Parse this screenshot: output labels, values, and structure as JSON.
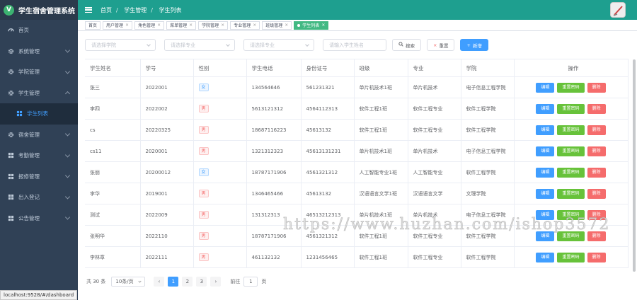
{
  "app": {
    "title": "学生宿舍管理系统",
    "logo_letter": "V"
  },
  "sidebar": {
    "items": [
      {
        "label": "首页",
        "icon": "dashboard-icon"
      },
      {
        "label": "系统管理",
        "icon": "gear-icon"
      },
      {
        "label": "学院管理",
        "icon": "gear-icon"
      },
      {
        "label": "学生管理",
        "icon": "gear-icon"
      },
      {
        "label": "学生列表",
        "icon": "grid-icon"
      },
      {
        "label": "宿舍管理",
        "icon": "gear-icon"
      },
      {
        "label": "考勤管理",
        "icon": "grid-icon"
      },
      {
        "label": "报修管理",
        "icon": "grid-icon"
      },
      {
        "label": "出入登记",
        "icon": "grid-icon"
      },
      {
        "label": "公告管理",
        "icon": "grid-icon"
      }
    ]
  },
  "breadcrumb": [
    "首页",
    "学生管理",
    "学生列表"
  ],
  "tags": [
    "首页",
    "用户管理",
    "角色管理",
    "菜单管理",
    "学院管理",
    "专业管理",
    "班级管理",
    "学生列表"
  ],
  "filters": {
    "college_placeholder": "请选择学院",
    "major_placeholder": "请选择专业",
    "class_placeholder": "请选择专业",
    "name_placeholder": "请输入学生姓名",
    "search_label": "搜索",
    "reset_label": "重置",
    "add_label": "新增"
  },
  "table": {
    "columns": [
      "学生姓名",
      "学号",
      "性别",
      "学生电话",
      "身份证号",
      "班级",
      "专业",
      "学院",
      "操作"
    ],
    "rows": [
      {
        "name": "张三",
        "no": "2022001",
        "gender": "女",
        "phone": "134564646",
        "id": "561231321",
        "cls": "单片机技术1班",
        "major": "单片机技术",
        "college": "电子信息工程学院"
      },
      {
        "name": "李四",
        "no": "2022002",
        "gender": "男",
        "phone": "5613121312",
        "id": "4564112313",
        "cls": "软件工程1班",
        "major": "软件工程专业",
        "college": "软件工程学院"
      },
      {
        "name": "cs",
        "no": "20220325",
        "gender": "男",
        "phone": "18687116223",
        "id": "45613132",
        "cls": "软件工程1班",
        "major": "软件工程专业",
        "college": "软件工程学院"
      },
      {
        "name": "cs11",
        "no": "2020001",
        "gender": "男",
        "phone": "1321312323",
        "id": "45613131231",
        "cls": "单片机技术1班",
        "major": "单片机技术",
        "college": "电子信息工程学院"
      },
      {
        "name": "张丽",
        "no": "20200012",
        "gender": "女",
        "phone": "18787171906",
        "id": "4561321312",
        "cls": "人工智能专业1班",
        "major": "人工智能专业",
        "college": "软件工程学院"
      },
      {
        "name": "李华",
        "no": "2019001",
        "gender": "男",
        "phone": "1346465466",
        "id": "45613132",
        "cls": "汉语语言文学1班",
        "major": "汉语语言文学",
        "college": "文理学院"
      },
      {
        "name": "测试",
        "no": "2022009",
        "gender": "男",
        "phone": "131312313",
        "id": "46513212313",
        "cls": "单片机技术1班",
        "major": "单片机技术",
        "college": "电子信息工程学院"
      },
      {
        "name": "张明华",
        "no": "2022110",
        "gender": "男",
        "phone": "18787171906",
        "id": "4561321312",
        "cls": "软件工程1班",
        "major": "软件工程专业",
        "college": "软件工程学院"
      },
      {
        "name": "李林章",
        "no": "2022111",
        "gender": "男",
        "phone": "461132132",
        "id": "1231456465",
        "cls": "软件工程1班",
        "major": "软件工程专业",
        "college": "软件工程学院"
      }
    ],
    "actions": {
      "edit": "编辑",
      "reset_pwd": "重置密码",
      "delete": "删除"
    }
  },
  "pagination": {
    "total": "共 30 条",
    "page_size": "10条/页",
    "pages": [
      "1",
      "2",
      "3"
    ],
    "current": "1",
    "goto_label": "前往",
    "goto_value": "1",
    "page_suffix": "页"
  },
  "watermark": "https://www.huzhan.com/ishop3572",
  "status_url": "localhost:9528/#/dashboard",
  "colors": {
    "navbar": "#1e9f8f",
    "sidebar": "#304156",
    "primary": "#409eff",
    "success": "#67c23a",
    "danger": "#f56c6c"
  }
}
